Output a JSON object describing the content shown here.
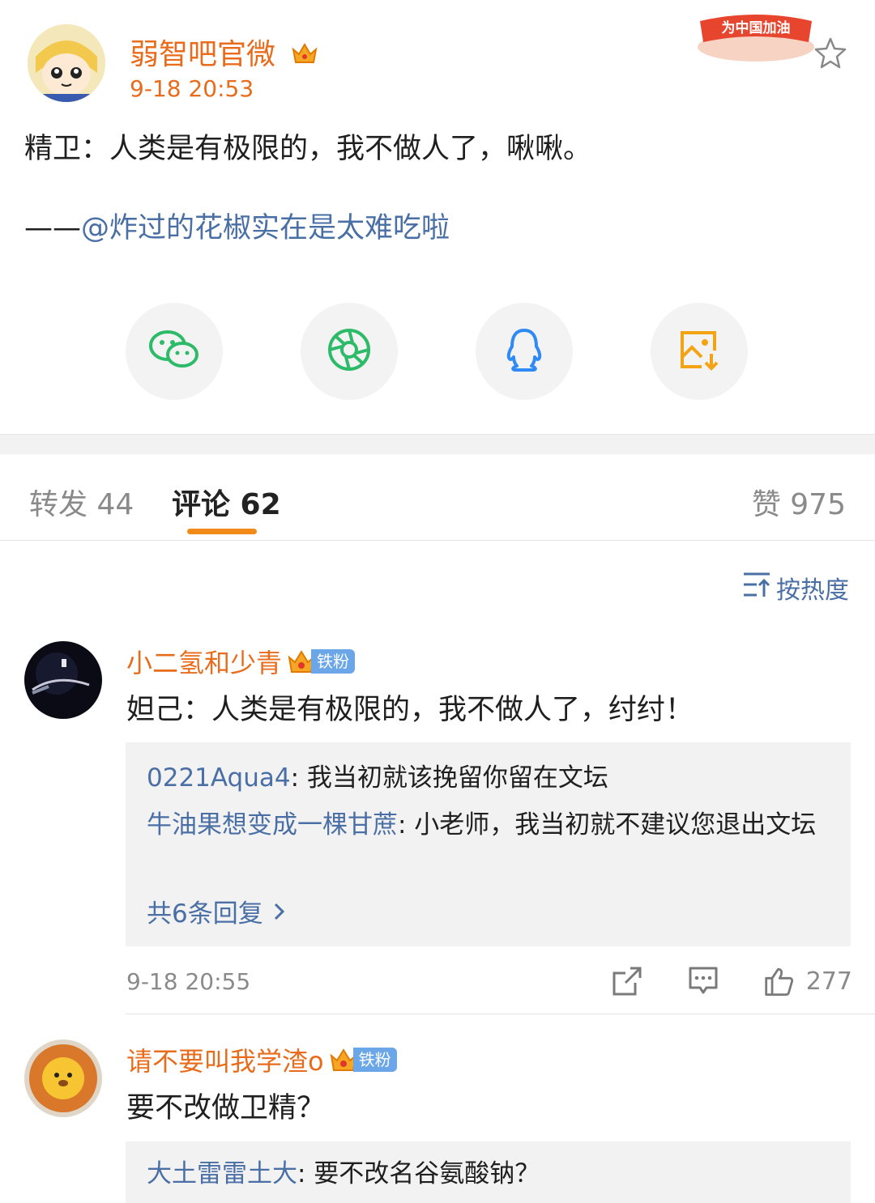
{
  "post": {
    "author": "弱智吧官微",
    "time": "9-18 20:53",
    "event_badge": "为中国加油",
    "text": "精卫：人类是有极限的，我不做人了，啾啾。",
    "credit_prefix": "——",
    "credit_mention": "@炸过的花椒实在是太难吃啦"
  },
  "share": {
    "wechat": "wechat-icon",
    "moments": "moments-icon",
    "qq": "qq-icon",
    "save": "save-image-icon"
  },
  "tabs": {
    "repost": "转发 44",
    "comment": "评论 62",
    "like": "赞 975"
  },
  "sort": {
    "label": "按热度"
  },
  "comments": [
    {
      "name": "小二氢和少青",
      "badge": "铁粉",
      "text": "妲己：人类是有极限的，我不做人了，纣纣！",
      "replies": [
        {
          "user": "0221Aqua4",
          "text": ": 我当初就该挽留你留在文坛"
        },
        {
          "user": "牛油果想变成一棵甘蔗",
          "text": ": 小老师，我当初就不建议您退出文坛"
        }
      ],
      "more": "共6条回复",
      "time": "9-18 20:55",
      "likes": "277"
    },
    {
      "name": "请不要叫我学渣o",
      "badge": "铁粉",
      "text": "要不改做卫精？",
      "replies": [
        {
          "user": "大土雷雷土大",
          "text": ": 要不改名谷氨酸钠？"
        }
      ]
    }
  ],
  "colors": {
    "accent": "#e96c1c",
    "link": "#4a6fa5",
    "tab_underline": "#f28a1a"
  }
}
